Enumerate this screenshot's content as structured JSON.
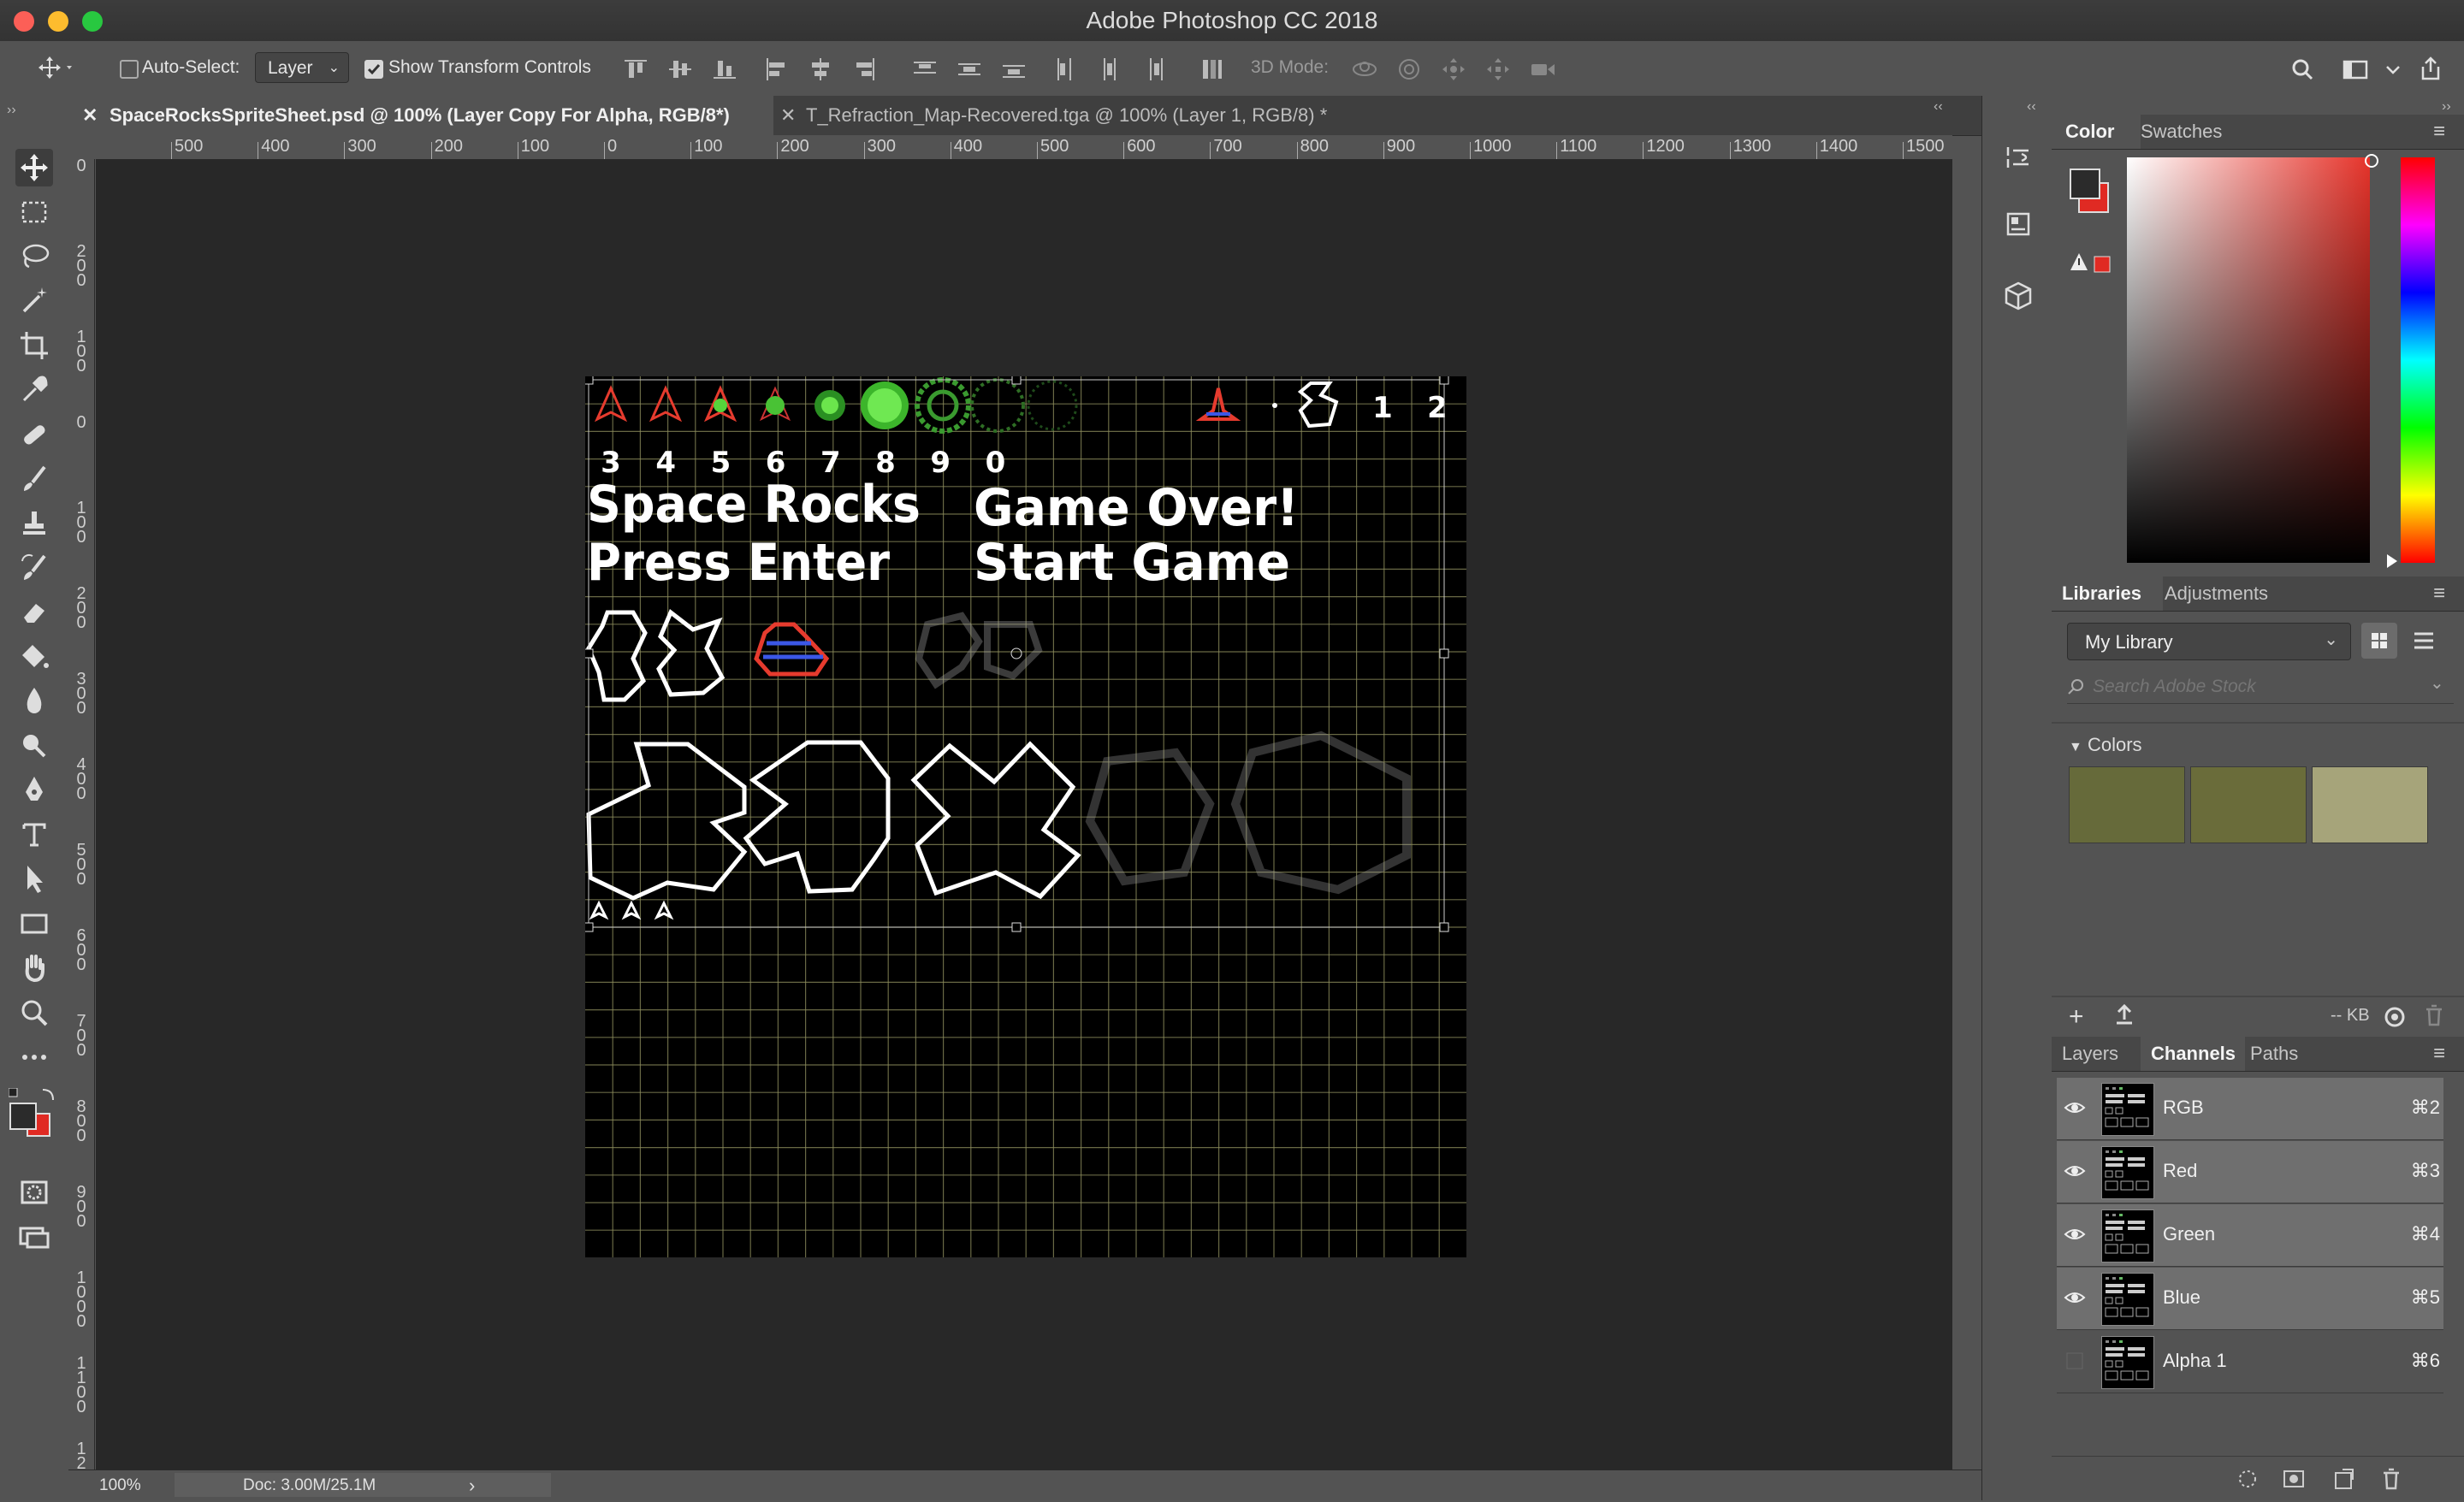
{
  "app": {
    "title": "Adobe Photoshop CC 2018"
  },
  "options_bar": {
    "auto_select_label": "Auto-Select:",
    "auto_select_checked": false,
    "auto_select_target": "Layer",
    "show_transform_label": "Show Transform Controls",
    "show_transform_checked": true,
    "mode_3d_label": "3D Mode:"
  },
  "document_tabs": [
    {
      "label": "SpaceRocksSpriteSheet.psd @ 100% (Layer Copy For Alpha, RGB/8*)",
      "active": true
    },
    {
      "label": "T_Refraction_Map-Recovered.tga @ 100% (Layer 1, RGB/8) *",
      "active": false
    }
  ],
  "ruler": {
    "h_labels": [
      "500",
      "400",
      "300",
      "200",
      "100",
      "0",
      "100",
      "200",
      "300",
      "400",
      "500",
      "600",
      "700",
      "800",
      "900",
      "1000",
      "1100",
      "1200",
      "1300",
      "1400",
      "1500"
    ],
    "v_labels": [
      "0",
      "200",
      "100",
      "0",
      "100",
      "200",
      "300",
      "400",
      "500",
      "600",
      "700",
      "800",
      "900",
      "1000",
      "1100",
      "1200"
    ]
  },
  "canvas": {
    "digits_top": [
      "1",
      "2"
    ],
    "digits_row": [
      "3",
      "4",
      "5",
      "6",
      "7",
      "8",
      "9",
      "0"
    ],
    "text_left_1": "Space Rocks",
    "text_left_2": "Press Enter",
    "text_right_1": "Game Over!",
    "text_right_2": "Start Game"
  },
  "status": {
    "zoom": "100%",
    "doc": "Doc: 3.00M/25.1M"
  },
  "color_panel": {
    "tabs": [
      "Color",
      "Swatches"
    ],
    "foreground": "#2b2b2b",
    "background": "#e02a23"
  },
  "libraries_panel": {
    "tabs": [
      "Libraries",
      "Adjustments"
    ],
    "library_name": "My Library",
    "search_placeholder": "Search Adobe Stock",
    "section": "Colors",
    "swatches": [
      "#666a3a",
      "#6a6c3a",
      "#a6a47a"
    ],
    "size_label": "-- KB"
  },
  "layers_panel": {
    "tabs": [
      "Layers",
      "Channels",
      "Paths"
    ],
    "channels": [
      {
        "name": "RGB",
        "shortcut": "⌘2",
        "visible": true
      },
      {
        "name": "Red",
        "shortcut": "⌘3",
        "visible": true
      },
      {
        "name": "Green",
        "shortcut": "⌘4",
        "visible": true
      },
      {
        "name": "Blue",
        "shortcut": "⌘5",
        "visible": true
      },
      {
        "name": "Alpha 1",
        "shortcut": "⌘6",
        "visible": false
      }
    ]
  }
}
